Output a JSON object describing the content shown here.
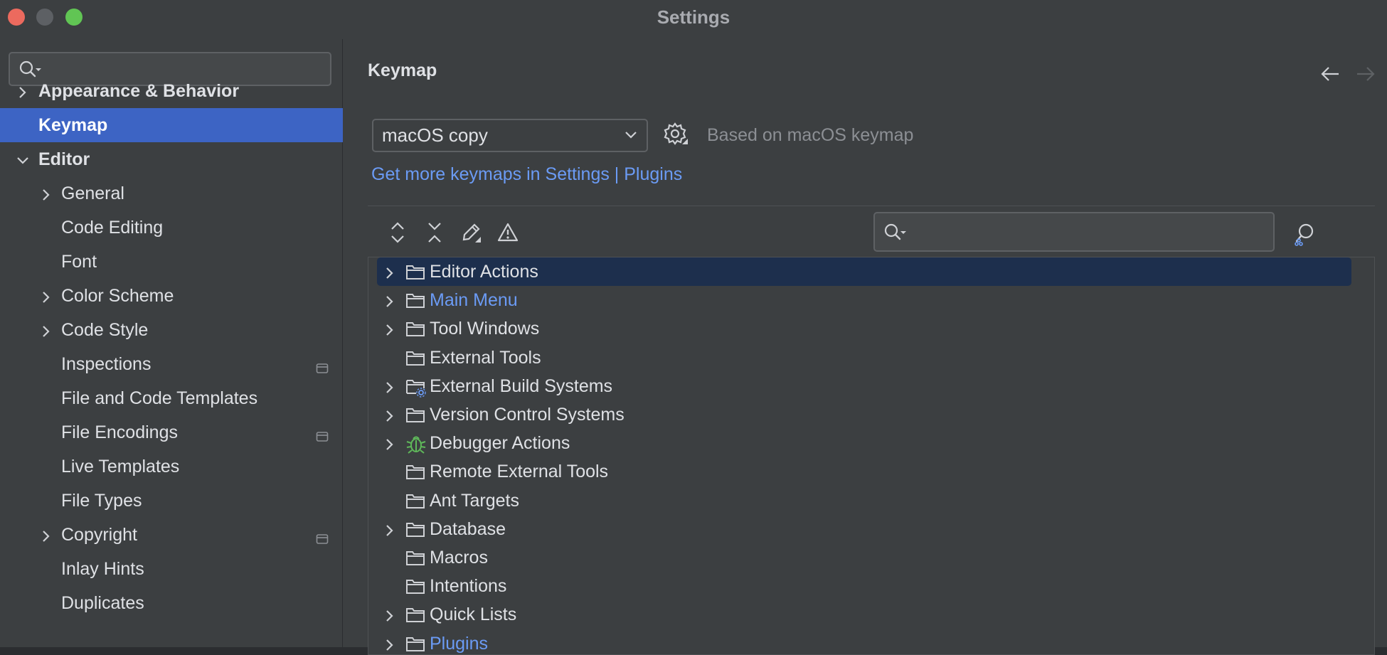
{
  "window": {
    "title": "Settings"
  },
  "sidebar": {
    "search": {
      "value": "",
      "icon": "search-icon"
    },
    "items": [
      {
        "label": "Appearance & Behavior",
        "expanded": false,
        "has_children": true,
        "level": 0
      },
      {
        "label": "Keymap",
        "selected": true,
        "level": 0
      },
      {
        "label": "Editor",
        "expanded": true,
        "has_children": true,
        "level": 0
      },
      {
        "label": "General",
        "has_children": true,
        "level": 1
      },
      {
        "label": "Code Editing",
        "level": 1
      },
      {
        "label": "Font",
        "level": 1
      },
      {
        "label": "Color Scheme",
        "has_children": true,
        "level": 1
      },
      {
        "label": "Code Style",
        "has_children": true,
        "level": 1
      },
      {
        "label": "Inspections",
        "level": 1,
        "badge": "project-settings-icon"
      },
      {
        "label": "File and Code Templates",
        "level": 1
      },
      {
        "label": "File Encodings",
        "level": 1,
        "badge": "project-settings-icon"
      },
      {
        "label": "Live Templates",
        "level": 1
      },
      {
        "label": "File Types",
        "level": 1
      },
      {
        "label": "Copyright",
        "has_children": true,
        "level": 1,
        "badge": "project-settings-icon"
      },
      {
        "label": "Inlay Hints",
        "level": 1
      },
      {
        "label": "Duplicates",
        "level": 1
      }
    ]
  },
  "main": {
    "title": "Keymap",
    "keymap_select": {
      "value": "macOS copy"
    },
    "based_on": "Based on macOS keymap",
    "more_link": "Get more keymaps in Settings | Plugins",
    "toolbar": [
      "expand-all-icon",
      "collapse-all-icon",
      "edit-shortcut-icon",
      "conflicts-warning-icon"
    ],
    "action_search": {
      "value": ""
    },
    "tree": [
      {
        "label": "Editor Actions",
        "expandable": true,
        "selected": true,
        "icon": "folder-icon"
      },
      {
        "label": "Main Menu",
        "expandable": true,
        "modified": true,
        "icon": "folder-icon"
      },
      {
        "label": "Tool Windows",
        "expandable": true,
        "icon": "folder-icon"
      },
      {
        "label": "External Tools",
        "expandable": false,
        "icon": "folder-icon"
      },
      {
        "label": "External Build Systems",
        "expandable": true,
        "icon": "folder-gear-icon"
      },
      {
        "label": "Version Control Systems",
        "expandable": true,
        "icon": "folder-icon"
      },
      {
        "label": "Debugger Actions",
        "expandable": true,
        "icon": "bug-icon"
      },
      {
        "label": "Remote External Tools",
        "expandable": false,
        "icon": "folder-icon"
      },
      {
        "label": "Ant Targets",
        "expandable": false,
        "icon": "folder-icon"
      },
      {
        "label": "Database",
        "expandable": true,
        "icon": "folder-icon"
      },
      {
        "label": "Macros",
        "expandable": false,
        "icon": "folder-icon"
      },
      {
        "label": "Intentions",
        "expandable": false,
        "icon": "folder-icon"
      },
      {
        "label": "Quick Lists",
        "expandable": true,
        "icon": "folder-icon"
      },
      {
        "label": "Plugins",
        "expandable": true,
        "modified": true,
        "icon": "folder-icon"
      }
    ]
  },
  "colors": {
    "selection": "#3d64c4",
    "tree_selection": "#1d2f4d",
    "link": "#6b9bf5",
    "bug": "#5fb85a"
  }
}
